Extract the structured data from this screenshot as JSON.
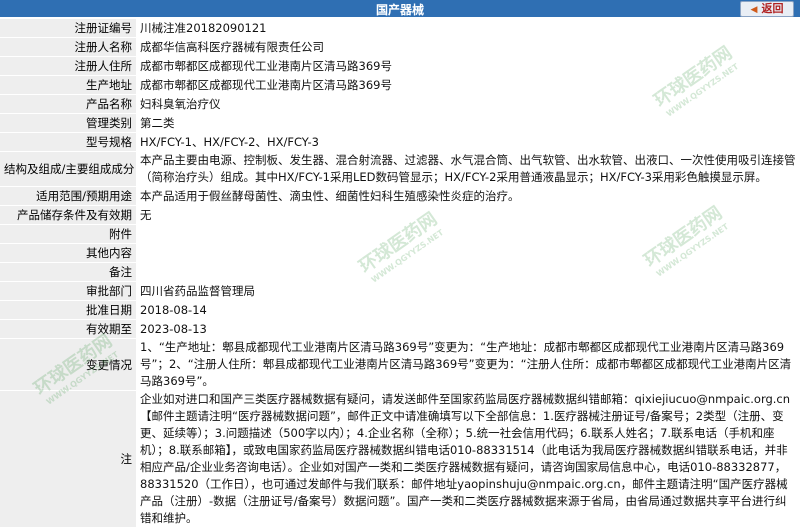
{
  "header": {
    "title": "国产器械",
    "back_label": "返回"
  },
  "rows": [
    {
      "label": "注册证编号",
      "value": "川械注准20182090121"
    },
    {
      "label": "注册人名称",
      "value": "成都华信高科医疗器械有限责任公司"
    },
    {
      "label": "注册人住所",
      "value": "成都市郫都区成都现代工业港南片区清马路369号"
    },
    {
      "label": "生产地址",
      "value": "成都市郫都区成都现代工业港南片区清马路369号"
    },
    {
      "label": "产品名称",
      "value": "妇科臭氧治疗仪"
    },
    {
      "label": "管理类别",
      "value": "第二类"
    },
    {
      "label": "型号规格",
      "value": "HX/FCY-1、HX/FCY-2、HX/FCY-3"
    },
    {
      "label": "结构及组成/主要组成成分",
      "value": "本产品主要由电源、控制板、发生器、混合射流器、过滤器、水气混合筒、出气软管、出水软管、出液口、一次性使用吸引连接管（简称治疗头）组成。其中HX/FCY-1采用LED数码管显示；HX/FCY-2采用普通液晶显示；HX/FCY-3采用彩色触摸显示屏。"
    },
    {
      "label": "适用范围/预期用途",
      "value": "本产品适用于假丝酵母菌性、滴虫性、细菌性妇科生殖感染性炎症的治疗。"
    },
    {
      "label": "产品储存条件及有效期",
      "value": "无"
    },
    {
      "label": "附件",
      "value": ""
    },
    {
      "label": "其他内容",
      "value": ""
    },
    {
      "label": "备注",
      "value": ""
    },
    {
      "label": "审批部门",
      "value": "四川省药品监督管理局"
    },
    {
      "label": "批准日期",
      "value": "2018-08-14"
    },
    {
      "label": "有效期至",
      "value": "2023-08-13"
    },
    {
      "label": "变更情况",
      "value": "1、“生产地址：郫县成都现代工业港南片区清马路369号”变更为：“生产地址：成都市郫都区成都现代工业港南片区清马路369号”；2、“注册人住所：郫县成都现代工业港南片区清马路369号”变更为：“注册人住所：成都市郫都区成都现代工业港南片区清马路369号”。"
    },
    {
      "label": "注",
      "value": "企业如对进口和国产三类医疗器械数据有疑问，请发送邮件至国家药监局医疗器械数据纠错邮箱：qixiejiucuo@nmpaic.org.cn【邮件主题请注明“医疗器械数据问题”，邮件正文中请准确填写以下全部信息：1.医疗器械注册证号/备案号；2类型（注册、变更、延续等）；3.问题描述（500字以内）；4.企业名称（全称）；5.统一社会信用代码；6.联系人姓名；7.联系电话（手机和座机）；8.联系邮箱】，或致电国家药监局医疗器械数据纠错电话010-88331514（此电话为我局医疗器械数据纠错联系电话，并非相应产品/企业业务咨询电话）。企业如对国产一类和二类医疗器械数据有疑问，请咨询国家局信息中心，电话010-88332877，88331520（工作日），也可通过发邮件与我们联系：邮件地址yaopinshuju@nmpaic.org.cn，邮件主题请注明“国产医疗器械产品（注册）-数据（注册证号/备案号）数据问题”。国产一类和二类医疗器械数据来源于省局，由省局通过数据共享平台进行纠错和维护。"
    }
  ],
  "watermarks": [
    {
      "text": "环球医药网",
      "sub": "WWW.QGYYZS.NET"
    },
    {
      "text": "环球医药网",
      "sub": "WWW.QGYYZS.NET"
    },
    {
      "text": "环球医药网",
      "sub": "WWW.QGYYZS.NET"
    },
    {
      "text": "环球医药网",
      "sub": "WWW.QGYYZS.NET"
    }
  ]
}
